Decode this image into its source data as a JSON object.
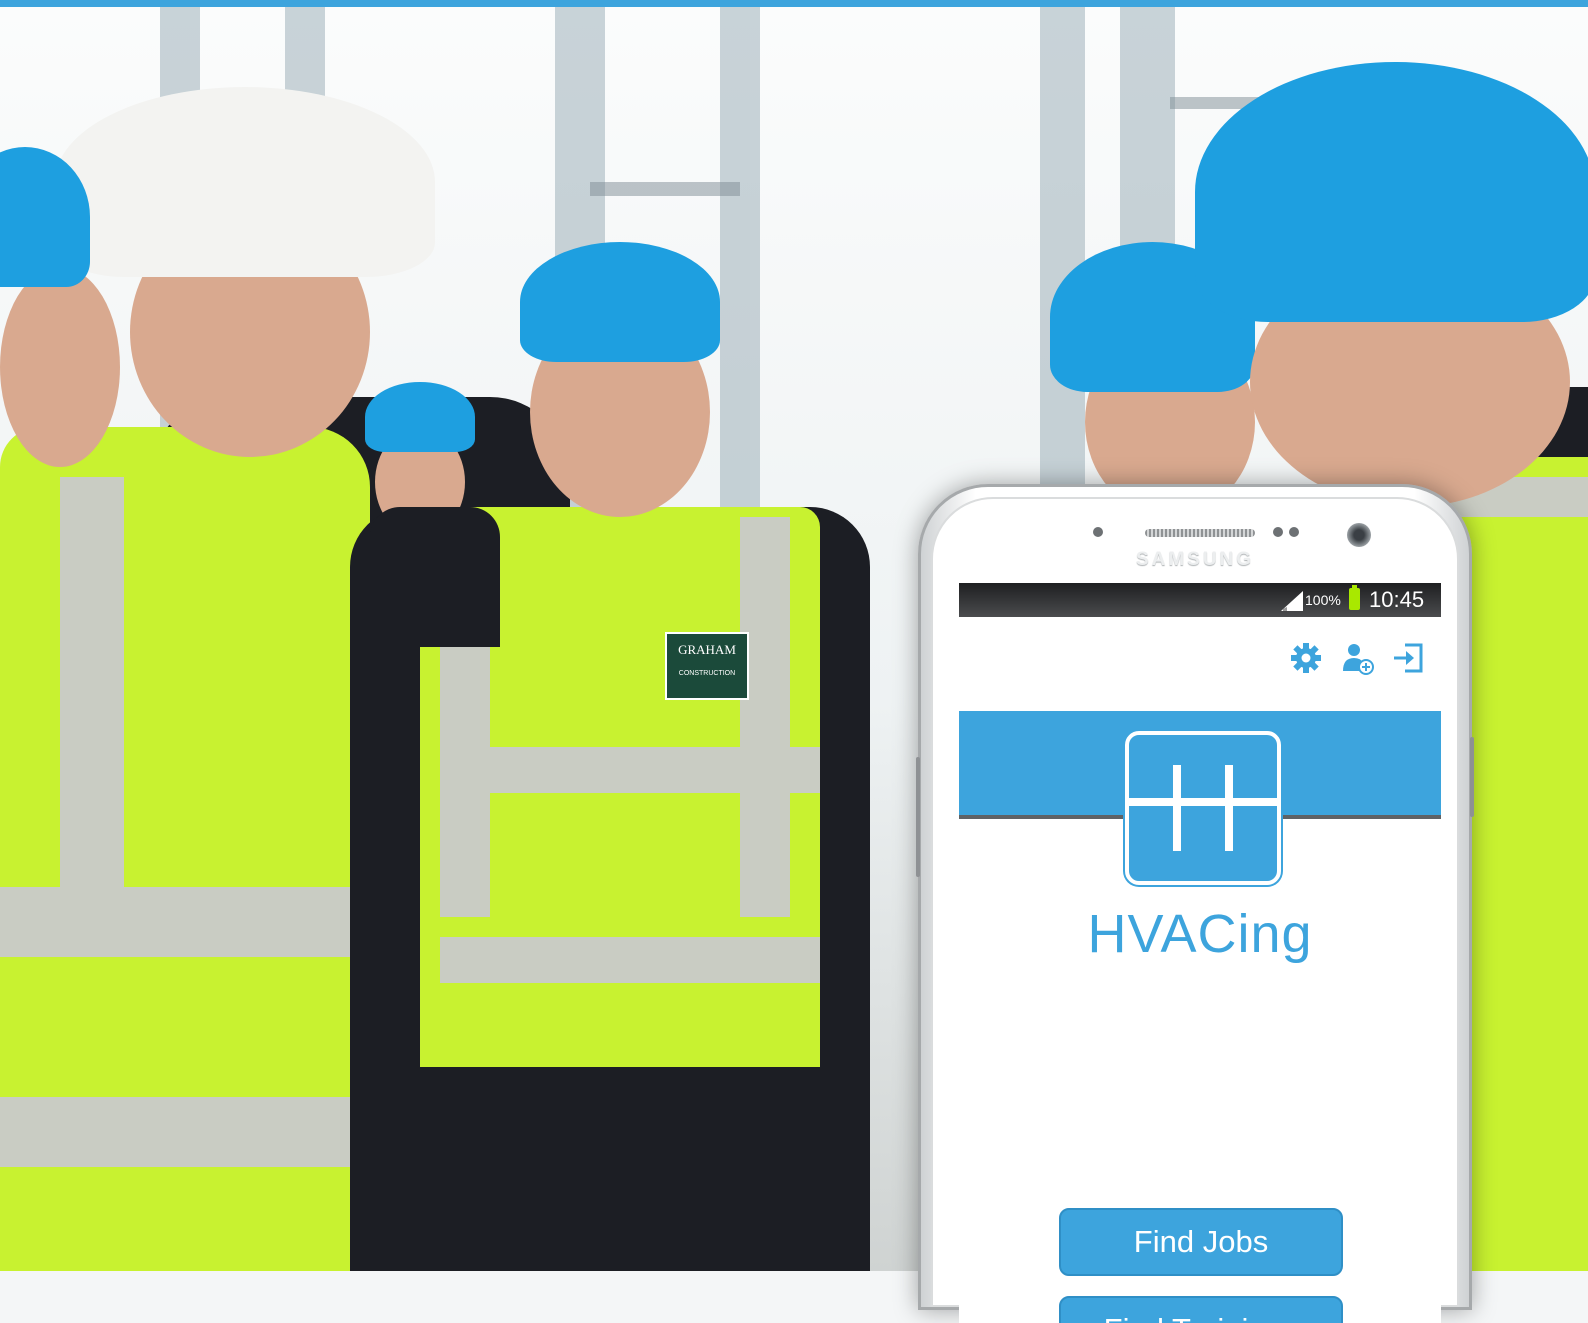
{
  "colors": {
    "accent": "#3da4dd",
    "vest": "#c8f230",
    "helmet_blue": "#1e9fe0",
    "helmet_white": "#f3f3f1"
  },
  "phone": {
    "brand": "SAMSUNG",
    "status_bar": {
      "signal_icon": "signal-icon",
      "battery_text": "100%",
      "battery_icon": "battery-icon",
      "time": "10:45"
    }
  },
  "app": {
    "toolbar_icons": [
      "gear-icon",
      "add-user-icon",
      "sign-in-icon"
    ],
    "logo_icon": "hvacing-h-logo-icon",
    "title": "HVACing",
    "buttons": {
      "find_jobs": "Find Jobs",
      "find_trainings": "Find Trainings"
    }
  },
  "background_photo": {
    "badge_line1": "GRAHAM",
    "badge_line2": "CONSTRUCTION"
  }
}
